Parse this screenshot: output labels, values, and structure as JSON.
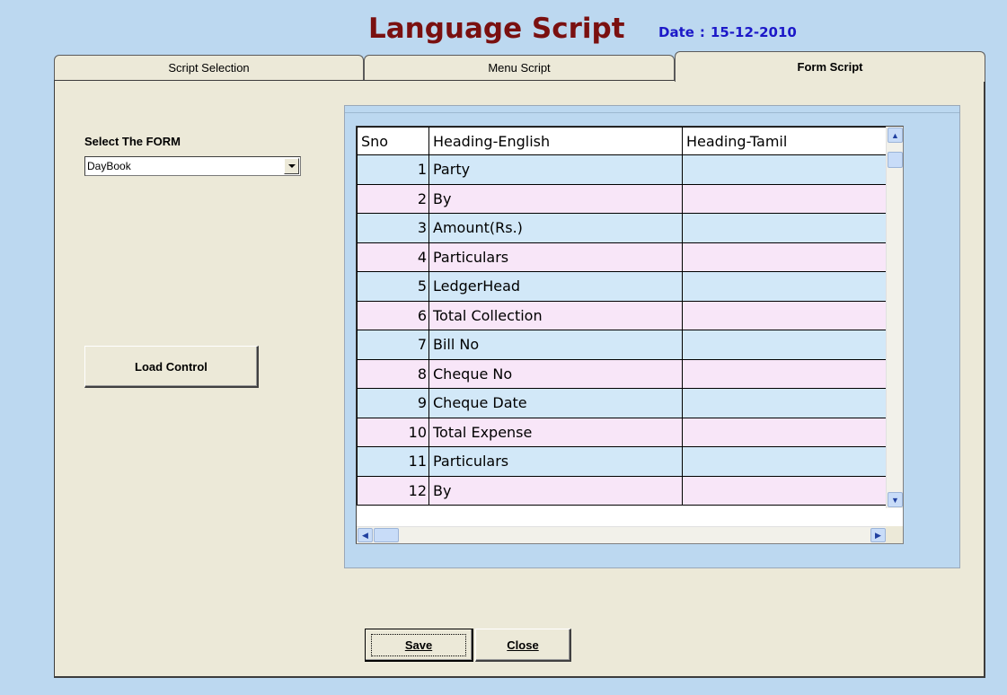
{
  "header": {
    "title": "Language Script",
    "date_label": "Date",
    "date_sep": ":",
    "date_value": "15-12-2010"
  },
  "tabs": [
    {
      "label": "Script Selection",
      "active": false
    },
    {
      "label": "Menu Script",
      "active": false
    },
    {
      "label": "Form Script",
      "active": true
    }
  ],
  "form": {
    "select_label": "Select The FORM",
    "selected_form": "DayBook",
    "load_button": "Load Control"
  },
  "grid": {
    "columns": [
      "Sno",
      "Heading-English",
      "Heading-Tamil"
    ],
    "rows": [
      {
        "sno": "1",
        "english": "Party",
        "tamil": ""
      },
      {
        "sno": "2",
        "english": "By",
        "tamil": ""
      },
      {
        "sno": "3",
        "english": "Amount(Rs.)",
        "tamil": ""
      },
      {
        "sno": "4",
        "english": "Particulars",
        "tamil": ""
      },
      {
        "sno": "5",
        "english": "LedgerHead",
        "tamil": ""
      },
      {
        "sno": "6",
        "english": "Total Collection",
        "tamil": ""
      },
      {
        "sno": "7",
        "english": "Bill No",
        "tamil": ""
      },
      {
        "sno": "8",
        "english": "Cheque No",
        "tamil": ""
      },
      {
        "sno": "9",
        "english": "Cheque Date",
        "tamil": ""
      },
      {
        "sno": "10",
        "english": "Total Expense",
        "tamil": ""
      },
      {
        "sno": "11",
        "english": "Particulars",
        "tamil": ""
      },
      {
        "sno": "12",
        "english": "By",
        "tamil": ""
      }
    ]
  },
  "buttons": {
    "save": "Save",
    "close": "Close"
  },
  "colors": {
    "title": "#7a1010",
    "date": "#1c18c8",
    "row_blue": "#d2e8f8",
    "row_pink": "#f8e6f8"
  }
}
